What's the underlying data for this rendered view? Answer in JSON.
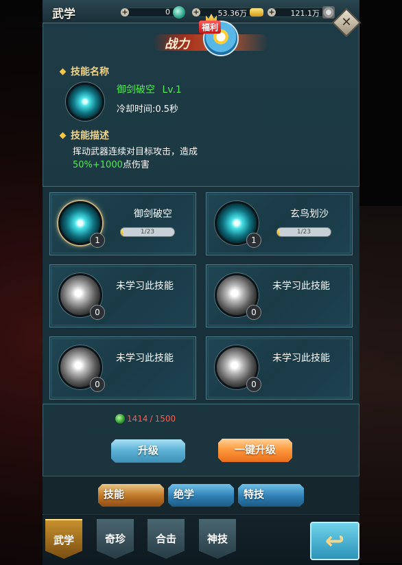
{
  "header": {
    "title": "武学",
    "resources": [
      {
        "icon": "jade-icon",
        "value": "0"
      },
      {
        "icon": "gold-ingot-icon",
        "value": "53.36万"
      },
      {
        "icon": "coin-icon",
        "value": "121.1万"
      }
    ]
  },
  "power_banner": {
    "label": "战力",
    "welfare_tag": "福利"
  },
  "skill_detail": {
    "name_heading": "技能名称",
    "name": "御剑破空",
    "level": "Lv.1",
    "cooldown": "冷却时间:0.5秒",
    "desc_heading": "技能描述",
    "desc_line1": "挥动武器连续对目标攻击，造成",
    "desc_value": "50%+1000",
    "desc_suffix": "点伤害"
  },
  "skills": [
    {
      "name": "御剑破空",
      "level": "1",
      "progress_text": "1/23",
      "progress": 0.0435,
      "learned": true
    },
    {
      "name": "玄鸟划沙",
      "level": "1",
      "progress_text": "1/23",
      "progress": 0.0435,
      "learned": true
    },
    {
      "name": "未学习此技能",
      "level": "0",
      "learned": false
    },
    {
      "name": "未学习此技能",
      "level": "0",
      "learned": false
    },
    {
      "name": "未学习此技能",
      "level": "0",
      "learned": false
    },
    {
      "name": "未学习此技能",
      "level": "0",
      "learned": false
    }
  ],
  "material": {
    "current": "1414",
    "total": "1500"
  },
  "buttons": {
    "upgrade": "升级",
    "upgrade_all": "一键升级"
  },
  "tabs": [
    "技能",
    "绝学",
    "特技"
  ],
  "nav": [
    "武学",
    "奇珍",
    "合击",
    "神技"
  ],
  "colors": {
    "accent_green": "#55e85a",
    "heading_gold": "#f0d38a",
    "warning_red": "#ff5a4e"
  }
}
